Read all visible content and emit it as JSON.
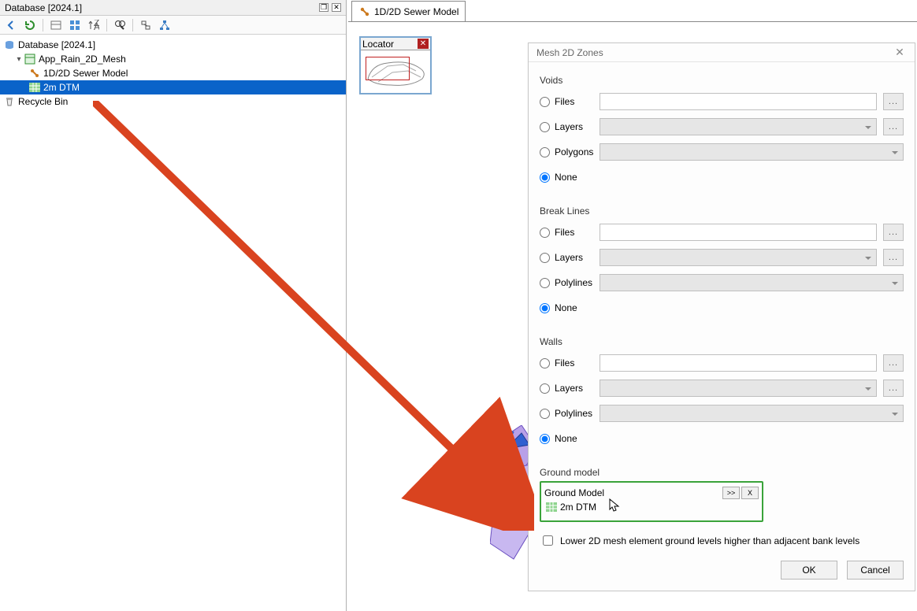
{
  "db_panel": {
    "title": "Database [2024.1]",
    "tree": {
      "root": "Database [2024.1]",
      "model_group": "App_Rain_2D_Mesh",
      "network": "1D/2D Sewer Model",
      "grid": "2m DTM",
      "bin": "Recycle Bin"
    }
  },
  "main_tab": {
    "label": "1D/2D Sewer Model"
  },
  "locator": {
    "title": "Locator"
  },
  "dialog": {
    "title": "Mesh 2D Zones",
    "voids": {
      "label": "Voids",
      "opt_files": "Files",
      "opt_layers": "Layers",
      "opt_polygons": "Polygons",
      "opt_none": "None"
    },
    "break": {
      "label": "Break Lines",
      "opt_files": "Files",
      "opt_layers": "Layers",
      "opt_polylines": "Polylines",
      "opt_none": "None"
    },
    "walls": {
      "label": "Walls",
      "opt_files": "Files",
      "opt_layers": "Layers",
      "opt_polylines": "Polylines",
      "opt_none": "None"
    },
    "ground": {
      "label": "Ground model",
      "box_title": "Ground Model",
      "item": "2m DTM",
      "expand": ">>",
      "clear": "X"
    },
    "lower_chk": "Lower 2D mesh element ground levels higher than adjacent bank levels",
    "ok": "OK",
    "cancel": "Cancel",
    "browse": "..."
  }
}
